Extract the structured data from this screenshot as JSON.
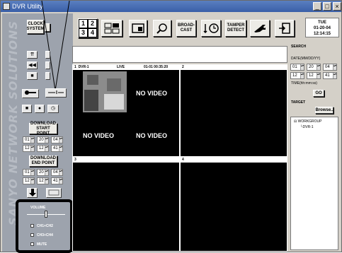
{
  "window": {
    "title": "DVR Utility"
  },
  "top_buttons": {
    "clock_system": "CLOCK SYSTEM",
    "split_1": "1",
    "split_2": "2",
    "split_3": "3",
    "split_4": "4",
    "broadcast": "BROAD- CAST",
    "tamper_detect": "TAMPER DETECT"
  },
  "clock": {
    "day": "TUE",
    "date": "01-20-04",
    "time": "12:14:15"
  },
  "sidebar": {
    "watermark": "SANYO NETWORK SOLUTIONS",
    "download_start": "DOWNLOAD START POINT",
    "download_end": "DOWNLOAD END POINT",
    "start_date": [
      "01",
      "20",
      "04"
    ],
    "start_time": [
      "12",
      "12",
      "41"
    ],
    "end_date": [
      "01",
      "20",
      "04"
    ],
    "end_time": [
      "12",
      "12",
      "41"
    ]
  },
  "volume": {
    "label": "VOLUME",
    "level": 0.5,
    "options": [
      "CH1+CH2",
      "CH3+CH4",
      "MUTE"
    ]
  },
  "tiles": [
    {
      "number": "1",
      "camera": "DVR-1",
      "status": "LIVE",
      "timestamp": "01-01 00:35:20"
    },
    {
      "number": "2"
    },
    {
      "number": "3"
    },
    {
      "number": "4"
    }
  ],
  "no_video": "NO VIDEO",
  "search": {
    "title": "SEARCH",
    "date_label": "DATE(MM/DD/YY)",
    "date": [
      "01",
      "20",
      "04"
    ],
    "time": [
      "12",
      "12",
      "41"
    ],
    "time_label": "TIME(hh:mm:ss)",
    "go_label": "GO",
    "target_label": "TARGET",
    "browse_label": "Browse..",
    "tree_root": "WORKGROUP",
    "tree_child": "DVR-1"
  },
  "colors": {
    "sidebar": "#9da3ad",
    "title_bar": "#3a5fa8",
    "callout_border": "#000000"
  }
}
